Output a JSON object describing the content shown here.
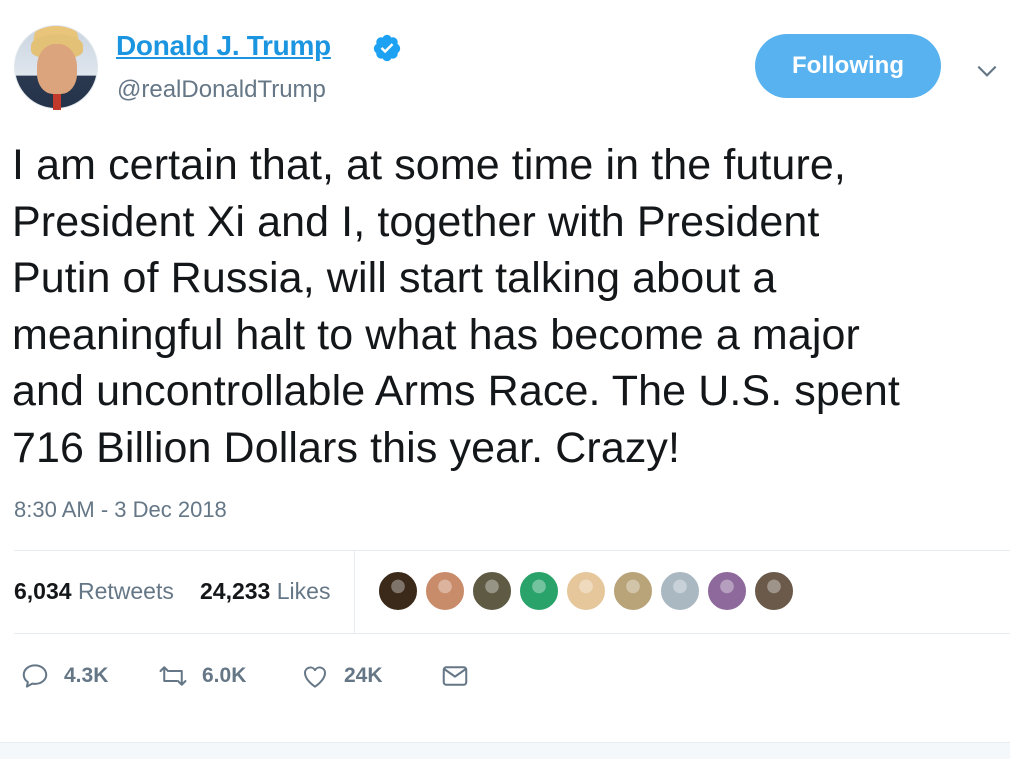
{
  "author": {
    "name": "Donald J. Trump",
    "handle": "@realDonaldTrump",
    "verified": true
  },
  "follow_button": {
    "label": "Following"
  },
  "tweet": {
    "text": "I am certain that, at some time in the future,\nPresident Xi and I, together with President\nPutin of Russia, will start talking about a\nmeaningful halt to what has become a major\nand uncontrollable Arms Race. The U.S. spent\n716 Billion Dollars this year. Crazy!",
    "timestamp": "8:30 AM - 3 Dec 2018"
  },
  "stats": {
    "retweets_count": "6,034",
    "retweets_label": "Retweets",
    "likes_count": "24,233",
    "likes_label": "Likes"
  },
  "likers": [
    {
      "name": "liker-1",
      "color": "#3b2a1a"
    },
    {
      "name": "liker-2",
      "color": "#c98c6a"
    },
    {
      "name": "liker-3",
      "color": "#5e5a44"
    },
    {
      "name": "liker-4",
      "color": "#2aa36b"
    },
    {
      "name": "liker-5",
      "color": "#e6c79c"
    },
    {
      "name": "liker-6",
      "color": "#b9a47a"
    },
    {
      "name": "liker-7",
      "color": "#aab8c2"
    },
    {
      "name": "liker-8",
      "color": "#8e6a9c"
    },
    {
      "name": "liker-9",
      "color": "#6b5a4a"
    }
  ],
  "actions": {
    "reply_count": "4.3K",
    "retweet_count": "6.0K",
    "like_count": "24K"
  },
  "colors": {
    "accent": "#1b95e0",
    "follow_bg": "#59b2f0",
    "muted": "#657786"
  }
}
